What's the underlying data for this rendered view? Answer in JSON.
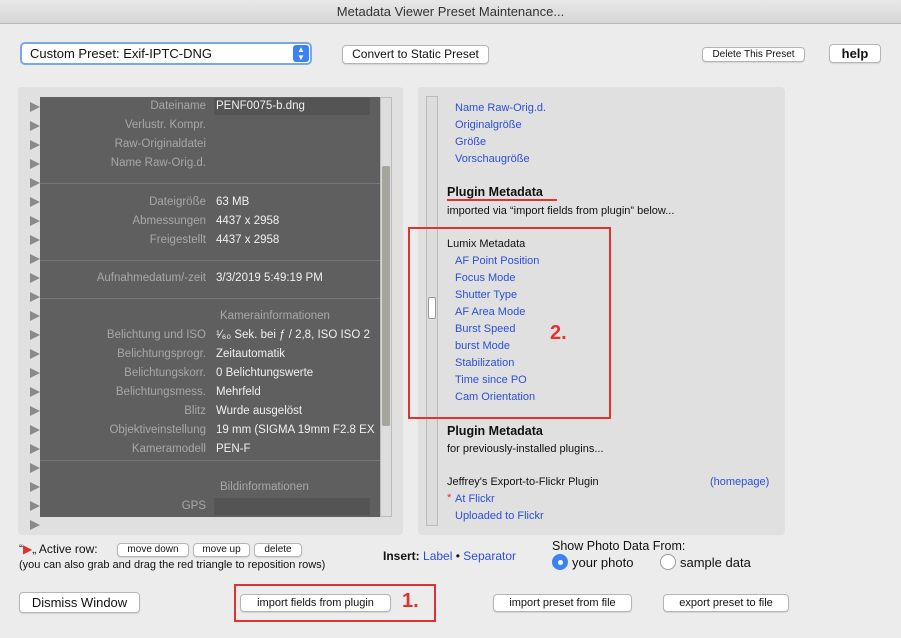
{
  "window": {
    "title": "Metadata Viewer Preset Maintenance..."
  },
  "toolbar": {
    "preset_select": "Custom Preset: Exif-IPTC-DNG",
    "convert": "Convert to Static Preset",
    "delete_preset": "Delete This Preset",
    "help": "help"
  },
  "left": {
    "rows": [
      {
        "label": "Dateiname",
        "value": "PENF0075-b.dng"
      },
      {
        "label": "Verlustr. Kompr.",
        "value": ""
      },
      {
        "label": "Raw-Originaldatei",
        "value": ""
      },
      {
        "label": "Name Raw-Orig.d.",
        "value": ""
      },
      {
        "label": "Dateigröße",
        "value": "63 MB"
      },
      {
        "label": "Abmessungen",
        "value": "4437 x 2958"
      },
      {
        "label": "Freigestellt",
        "value": "4437 x 2958"
      },
      {
        "label": "Aufnahmedatum/-zeit",
        "value": "3/3/2019 5:49:19 PM"
      },
      {
        "label": "Belichtung und ISO",
        "value": "¹⁄₆₀ Sek. bei ƒ / 2,8, ISO ISO 2"
      },
      {
        "label": "Belichtungsprogr.",
        "value": "Zeitautomatik"
      },
      {
        "label": "Belichtungskorr.",
        "value": "0 Belichtungswerte"
      },
      {
        "label": "Belichtungsmess.",
        "value": "Mehrfeld"
      },
      {
        "label": "Blitz",
        "value": "Wurde ausgelöst"
      },
      {
        "label": "Objektiveinstellung",
        "value": "19 mm (SIGMA 19mm F2.8 EX"
      },
      {
        "label": "Kameramodell",
        "value": "PEN-F"
      },
      {
        "label": "GPS",
        "value": ""
      }
    ],
    "sections": [
      "Kamerainformationen",
      "Bildinformationen"
    ]
  },
  "right": {
    "top_links": [
      "Name Raw-Orig.d.",
      "Originalgröße",
      "Größe",
      "Vorschaugröße"
    ],
    "plugin_heading": "Plugin Metadata",
    "plugin_sub": "imported via “import fields from plugin” below...",
    "lumix_title": "Lumix Metadata",
    "lumix_items": [
      "AF Point Position",
      "Focus Mode",
      "Shutter Type",
      "AF Area Mode",
      "Burst Speed",
      "burst Mode",
      "Stabilization",
      "Time since PO",
      "Cam Orientation"
    ],
    "plugin_heading2": "Plugin Metadata",
    "plugin_sub2": "for previously-installed plugins...",
    "flickr_title": "Jeffrey's Export-to-Flickr Plugin",
    "homepage": "(homepage)",
    "flickr_star": "*",
    "flickr_items": [
      "At Flickr",
      "Uploaded to Flickr"
    ]
  },
  "annotations": {
    "one": "1.",
    "two": "2.",
    "accent": "#e2322f"
  },
  "bottom": {
    "active_prefix": "“",
    "active_suffix": "„ Active row:",
    "move_down": "move down",
    "move_up": "move up",
    "delete": "delete",
    "hint": "(you can also grab and drag the red triangle to reposition rows)",
    "insert": "Insert:",
    "label": "Label",
    "bullet": "•",
    "separator": "Separator",
    "show_from": "Show Photo Data From:",
    "your_photo": "your photo",
    "sample_data": "sample data",
    "selected": "your photo",
    "dismiss": "Dismiss Window",
    "import_fields": "import fields from plugin",
    "import_preset": "import preset from file",
    "export_preset": "export preset to file"
  }
}
